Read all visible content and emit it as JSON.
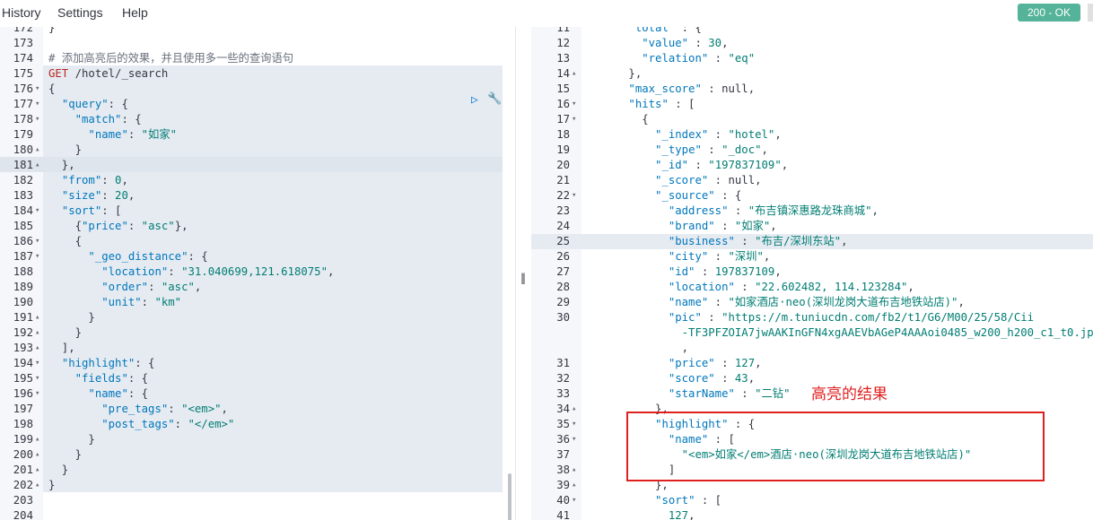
{
  "menu": {
    "history": "History",
    "settings": "Settings",
    "help": "Help"
  },
  "status": "200 - OK",
  "annotation": "高亮的结果",
  "left_lines": [
    {
      "n": "172",
      "fold": "",
      "t": [
        [
          "p",
          "}"
        ]
      ]
    },
    {
      "n": "173",
      "fold": "",
      "t": []
    },
    {
      "n": "174",
      "fold": "",
      "t": [
        [
          "c",
          "# 添加高亮后的效果，并且使用多一些的查询语句"
        ]
      ]
    },
    {
      "n": "175",
      "fold": "",
      "t": [
        [
          "m",
          "GET"
        ],
        [
          "u",
          " /hotel/_search"
        ]
      ]
    },
    {
      "n": "176",
      "fold": "▾",
      "t": [
        [
          "p",
          "{"
        ]
      ]
    },
    {
      "n": "177",
      "fold": "▾",
      "t": [
        [
          "p",
          "  "
        ],
        [
          "k",
          "\"query\""
        ],
        [
          "p",
          ": {"
        ]
      ]
    },
    {
      "n": "178",
      "fold": "▾",
      "t": [
        [
          "p",
          "    "
        ],
        [
          "k",
          "\"match\""
        ],
        [
          "p",
          ": {"
        ]
      ]
    },
    {
      "n": "179",
      "fold": "",
      "t": [
        [
          "p",
          "      "
        ],
        [
          "k",
          "\"name\""
        ],
        [
          "p",
          ": "
        ],
        [
          "s",
          "\"如家\""
        ]
      ]
    },
    {
      "n": "180",
      "fold": "▴",
      "t": [
        [
          "p",
          "    }"
        ]
      ]
    },
    {
      "n": "181",
      "fold": "▴",
      "t": [
        [
          "p",
          "  },"
        ]
      ]
    },
    {
      "n": "182",
      "fold": "",
      "t": [
        [
          "p",
          "  "
        ],
        [
          "k",
          "\"from\""
        ],
        [
          "p",
          ": "
        ],
        [
          "n",
          "0"
        ],
        [
          "p",
          ","
        ]
      ]
    },
    {
      "n": "183",
      "fold": "",
      "t": [
        [
          "p",
          "  "
        ],
        [
          "k",
          "\"size\""
        ],
        [
          "p",
          ": "
        ],
        [
          "n",
          "20"
        ],
        [
          "p",
          ","
        ]
      ]
    },
    {
      "n": "184",
      "fold": "▾",
      "t": [
        [
          "p",
          "  "
        ],
        [
          "k",
          "\"sort\""
        ],
        [
          "p",
          ": ["
        ]
      ]
    },
    {
      "n": "185",
      "fold": "",
      "t": [
        [
          "p",
          "    {"
        ],
        [
          "k",
          "\"price\""
        ],
        [
          "p",
          ": "
        ],
        [
          "s",
          "\"asc\""
        ],
        [
          "p",
          "},"
        ]
      ]
    },
    {
      "n": "186",
      "fold": "▾",
      "t": [
        [
          "p",
          "    {"
        ]
      ]
    },
    {
      "n": "187",
      "fold": "▾",
      "t": [
        [
          "p",
          "      "
        ],
        [
          "k",
          "\"_geo_distance\""
        ],
        [
          "p",
          ": {"
        ]
      ]
    },
    {
      "n": "188",
      "fold": "",
      "t": [
        [
          "p",
          "        "
        ],
        [
          "k",
          "\"location\""
        ],
        [
          "p",
          ": "
        ],
        [
          "s",
          "\"31.040699,121.618075\""
        ],
        [
          "p",
          ","
        ]
      ]
    },
    {
      "n": "189",
      "fold": "",
      "t": [
        [
          "p",
          "        "
        ],
        [
          "k",
          "\"order\""
        ],
        [
          "p",
          ": "
        ],
        [
          "s",
          "\"asc\""
        ],
        [
          "p",
          ","
        ]
      ]
    },
    {
      "n": "190",
      "fold": "",
      "t": [
        [
          "p",
          "        "
        ],
        [
          "k",
          "\"unit\""
        ],
        [
          "p",
          ": "
        ],
        [
          "s",
          "\"km\""
        ]
      ]
    },
    {
      "n": "191",
      "fold": "▴",
      "t": [
        [
          "p",
          "      }"
        ]
      ]
    },
    {
      "n": "192",
      "fold": "▴",
      "t": [
        [
          "p",
          "    }"
        ]
      ]
    },
    {
      "n": "193",
      "fold": "▴",
      "t": [
        [
          "p",
          "  ],"
        ]
      ]
    },
    {
      "n": "194",
      "fold": "▾",
      "t": [
        [
          "p",
          "  "
        ],
        [
          "k",
          "\"highlight\""
        ],
        [
          "p",
          ": {"
        ]
      ]
    },
    {
      "n": "195",
      "fold": "▾",
      "t": [
        [
          "p",
          "    "
        ],
        [
          "k",
          "\"fields\""
        ],
        [
          "p",
          ": {"
        ]
      ]
    },
    {
      "n": "196",
      "fold": "▾",
      "t": [
        [
          "p",
          "      "
        ],
        [
          "k",
          "\"name\""
        ],
        [
          "p",
          ": {"
        ]
      ]
    },
    {
      "n": "197",
      "fold": "",
      "t": [
        [
          "p",
          "        "
        ],
        [
          "k",
          "\"pre_tags\""
        ],
        [
          "p",
          ": "
        ],
        [
          "s",
          "\"<em>\""
        ],
        [
          "p",
          ","
        ]
      ]
    },
    {
      "n": "198",
      "fold": "",
      "t": [
        [
          "p",
          "        "
        ],
        [
          "k",
          "\"post_tags\""
        ],
        [
          "p",
          ": "
        ],
        [
          "s",
          "\"</em>\""
        ]
      ]
    },
    {
      "n": "199",
      "fold": "▴",
      "t": [
        [
          "p",
          "      }"
        ]
      ]
    },
    {
      "n": "200",
      "fold": "▴",
      "t": [
        [
          "p",
          "    }"
        ]
      ]
    },
    {
      "n": "201",
      "fold": "▴",
      "t": [
        [
          "p",
          "  }"
        ]
      ]
    },
    {
      "n": "202",
      "fold": "▴",
      "t": [
        [
          "p",
          "}"
        ]
      ]
    },
    {
      "n": "203",
      "fold": "",
      "t": []
    },
    {
      "n": "204",
      "fold": "",
      "t": []
    }
  ],
  "right_lines": [
    {
      "n": "11",
      "fold": "",
      "t": [
        [
          "p",
          "      "
        ],
        [
          "k",
          "\"total\""
        ],
        [
          "p",
          " : {"
        ]
      ]
    },
    {
      "n": "12",
      "fold": "",
      "t": [
        [
          "p",
          "        "
        ],
        [
          "k",
          "\"value\""
        ],
        [
          "p",
          " : "
        ],
        [
          "n",
          "30"
        ],
        [
          "p",
          ","
        ]
      ]
    },
    {
      "n": "13",
      "fold": "",
      "t": [
        [
          "p",
          "        "
        ],
        [
          "k",
          "\"relation\""
        ],
        [
          "p",
          " : "
        ],
        [
          "s",
          "\"eq\""
        ]
      ]
    },
    {
      "n": "14",
      "fold": "▴",
      "t": [
        [
          "p",
          "      },"
        ]
      ]
    },
    {
      "n": "15",
      "fold": "",
      "t": [
        [
          "p",
          "      "
        ],
        [
          "k",
          "\"max_score\""
        ],
        [
          "p",
          " : "
        ],
        [
          "p",
          "null,"
        ]
      ]
    },
    {
      "n": "16",
      "fold": "▾",
      "t": [
        [
          "p",
          "      "
        ],
        [
          "k",
          "\"hits\""
        ],
        [
          "p",
          " : ["
        ]
      ]
    },
    {
      "n": "17",
      "fold": "▾",
      "t": [
        [
          "p",
          "        {"
        ]
      ]
    },
    {
      "n": "18",
      "fold": "",
      "t": [
        [
          "p",
          "          "
        ],
        [
          "k",
          "\"_index\""
        ],
        [
          "p",
          " : "
        ],
        [
          "s",
          "\"hotel\""
        ],
        [
          "p",
          ","
        ]
      ]
    },
    {
      "n": "19",
      "fold": "",
      "t": [
        [
          "p",
          "          "
        ],
        [
          "k",
          "\"_type\""
        ],
        [
          "p",
          " : "
        ],
        [
          "s",
          "\"_doc\""
        ],
        [
          "p",
          ","
        ]
      ]
    },
    {
      "n": "20",
      "fold": "",
      "t": [
        [
          "p",
          "          "
        ],
        [
          "k",
          "\"_id\""
        ],
        [
          "p",
          " : "
        ],
        [
          "s",
          "\"197837109\""
        ],
        [
          "p",
          ","
        ]
      ]
    },
    {
      "n": "21",
      "fold": "",
      "t": [
        [
          "p",
          "          "
        ],
        [
          "k",
          "\"_score\""
        ],
        [
          "p",
          " : "
        ],
        [
          "p",
          "null,"
        ]
      ]
    },
    {
      "n": "22",
      "fold": "▾",
      "t": [
        [
          "p",
          "          "
        ],
        [
          "k",
          "\"_source\""
        ],
        [
          "p",
          " : {"
        ]
      ]
    },
    {
      "n": "23",
      "fold": "",
      "t": [
        [
          "p",
          "            "
        ],
        [
          "k",
          "\"address\""
        ],
        [
          "p",
          " : "
        ],
        [
          "s",
          "\"布吉镇深惠路龙珠商城\""
        ],
        [
          "p",
          ","
        ]
      ]
    },
    {
      "n": "24",
      "fold": "",
      "t": [
        [
          "p",
          "            "
        ],
        [
          "k",
          "\"brand\""
        ],
        [
          "p",
          " : "
        ],
        [
          "s",
          "\"如家\""
        ],
        [
          "p",
          ","
        ]
      ]
    },
    {
      "n": "25",
      "fold": "",
      "t": [
        [
          "p",
          "            "
        ],
        [
          "k",
          "\"business\""
        ],
        [
          "p",
          " : "
        ],
        [
          "s",
          "\"布吉/深圳东站\""
        ],
        [
          "p",
          ","
        ]
      ]
    },
    {
      "n": "26",
      "fold": "",
      "t": [
        [
          "p",
          "            "
        ],
        [
          "k",
          "\"city\""
        ],
        [
          "p",
          " : "
        ],
        [
          "s",
          "\"深圳\""
        ],
        [
          "p",
          ","
        ]
      ]
    },
    {
      "n": "27",
      "fold": "",
      "t": [
        [
          "p",
          "            "
        ],
        [
          "k",
          "\"id\""
        ],
        [
          "p",
          " : "
        ],
        [
          "n",
          "197837109"
        ],
        [
          "p",
          ","
        ]
      ]
    },
    {
      "n": "28",
      "fold": "",
      "t": [
        [
          "p",
          "            "
        ],
        [
          "k",
          "\"location\""
        ],
        [
          "p",
          " : "
        ],
        [
          "s",
          "\"22.602482, 114.123284\""
        ],
        [
          "p",
          ","
        ]
      ]
    },
    {
      "n": "29",
      "fold": "",
      "t": [
        [
          "p",
          "            "
        ],
        [
          "k",
          "\"name\""
        ],
        [
          "p",
          " : "
        ],
        [
          "s",
          "\"如家酒店·neo(深圳龙岗大道布吉地铁站店)\""
        ],
        [
          "p",
          ","
        ]
      ]
    },
    {
      "n": "30",
      "fold": "",
      "t": [
        [
          "p",
          "            "
        ],
        [
          "k",
          "\"pic\""
        ],
        [
          "p",
          " : "
        ],
        [
          "s",
          "\"https://m.tuniucdn.com/fb2/t1/G6/M00/25/58/Cii"
        ]
      ]
    },
    {
      "n": "",
      "fold": "",
      "t": [
        [
          "s",
          "              -TF3PFZOIA7jwAAKInGFN4xgAAEVbAGeP4AAAoi0485_w200_h200_c1_t0.jpg\""
        ]
      ]
    },
    {
      "n": "",
      "fold": "",
      "t": [
        [
          "p",
          "              ,"
        ]
      ]
    },
    {
      "n": "31",
      "fold": "",
      "t": [
        [
          "p",
          "            "
        ],
        [
          "k",
          "\"price\""
        ],
        [
          "p",
          " : "
        ],
        [
          "n",
          "127"
        ],
        [
          "p",
          ","
        ]
      ]
    },
    {
      "n": "32",
      "fold": "",
      "t": [
        [
          "p",
          "            "
        ],
        [
          "k",
          "\"score\""
        ],
        [
          "p",
          " : "
        ],
        [
          "n",
          "43"
        ],
        [
          "p",
          ","
        ]
      ]
    },
    {
      "n": "33",
      "fold": "",
      "t": [
        [
          "p",
          "            "
        ],
        [
          "k",
          "\"starName\""
        ],
        [
          "p",
          " : "
        ],
        [
          "s",
          "\"二钻\""
        ]
      ]
    },
    {
      "n": "34",
      "fold": "▴",
      "t": [
        [
          "p",
          "          },"
        ]
      ]
    },
    {
      "n": "35",
      "fold": "▾",
      "t": [
        [
          "p",
          "          "
        ],
        [
          "k",
          "\"highlight\""
        ],
        [
          "p",
          " : {"
        ]
      ]
    },
    {
      "n": "36",
      "fold": "▾",
      "t": [
        [
          "p",
          "            "
        ],
        [
          "k",
          "\"name\""
        ],
        [
          "p",
          " : ["
        ]
      ]
    },
    {
      "n": "37",
      "fold": "",
      "t": [
        [
          "p",
          "              "
        ],
        [
          "s",
          "\"<em>如家</em>酒店·neo(深圳龙岗大道布吉地铁站店)\""
        ]
      ]
    },
    {
      "n": "38",
      "fold": "▴",
      "t": [
        [
          "p",
          "            ]"
        ]
      ]
    },
    {
      "n": "39",
      "fold": "▴",
      "t": [
        [
          "p",
          "          },"
        ]
      ]
    },
    {
      "n": "40",
      "fold": "▾",
      "t": [
        [
          "p",
          "          "
        ],
        [
          "k",
          "\"sort\""
        ],
        [
          "p",
          " : ["
        ]
      ]
    },
    {
      "n": "41",
      "fold": "",
      "t": [
        [
          "p",
          "            "
        ],
        [
          "n",
          "127"
        ],
        [
          "p",
          ","
        ]
      ]
    }
  ]
}
